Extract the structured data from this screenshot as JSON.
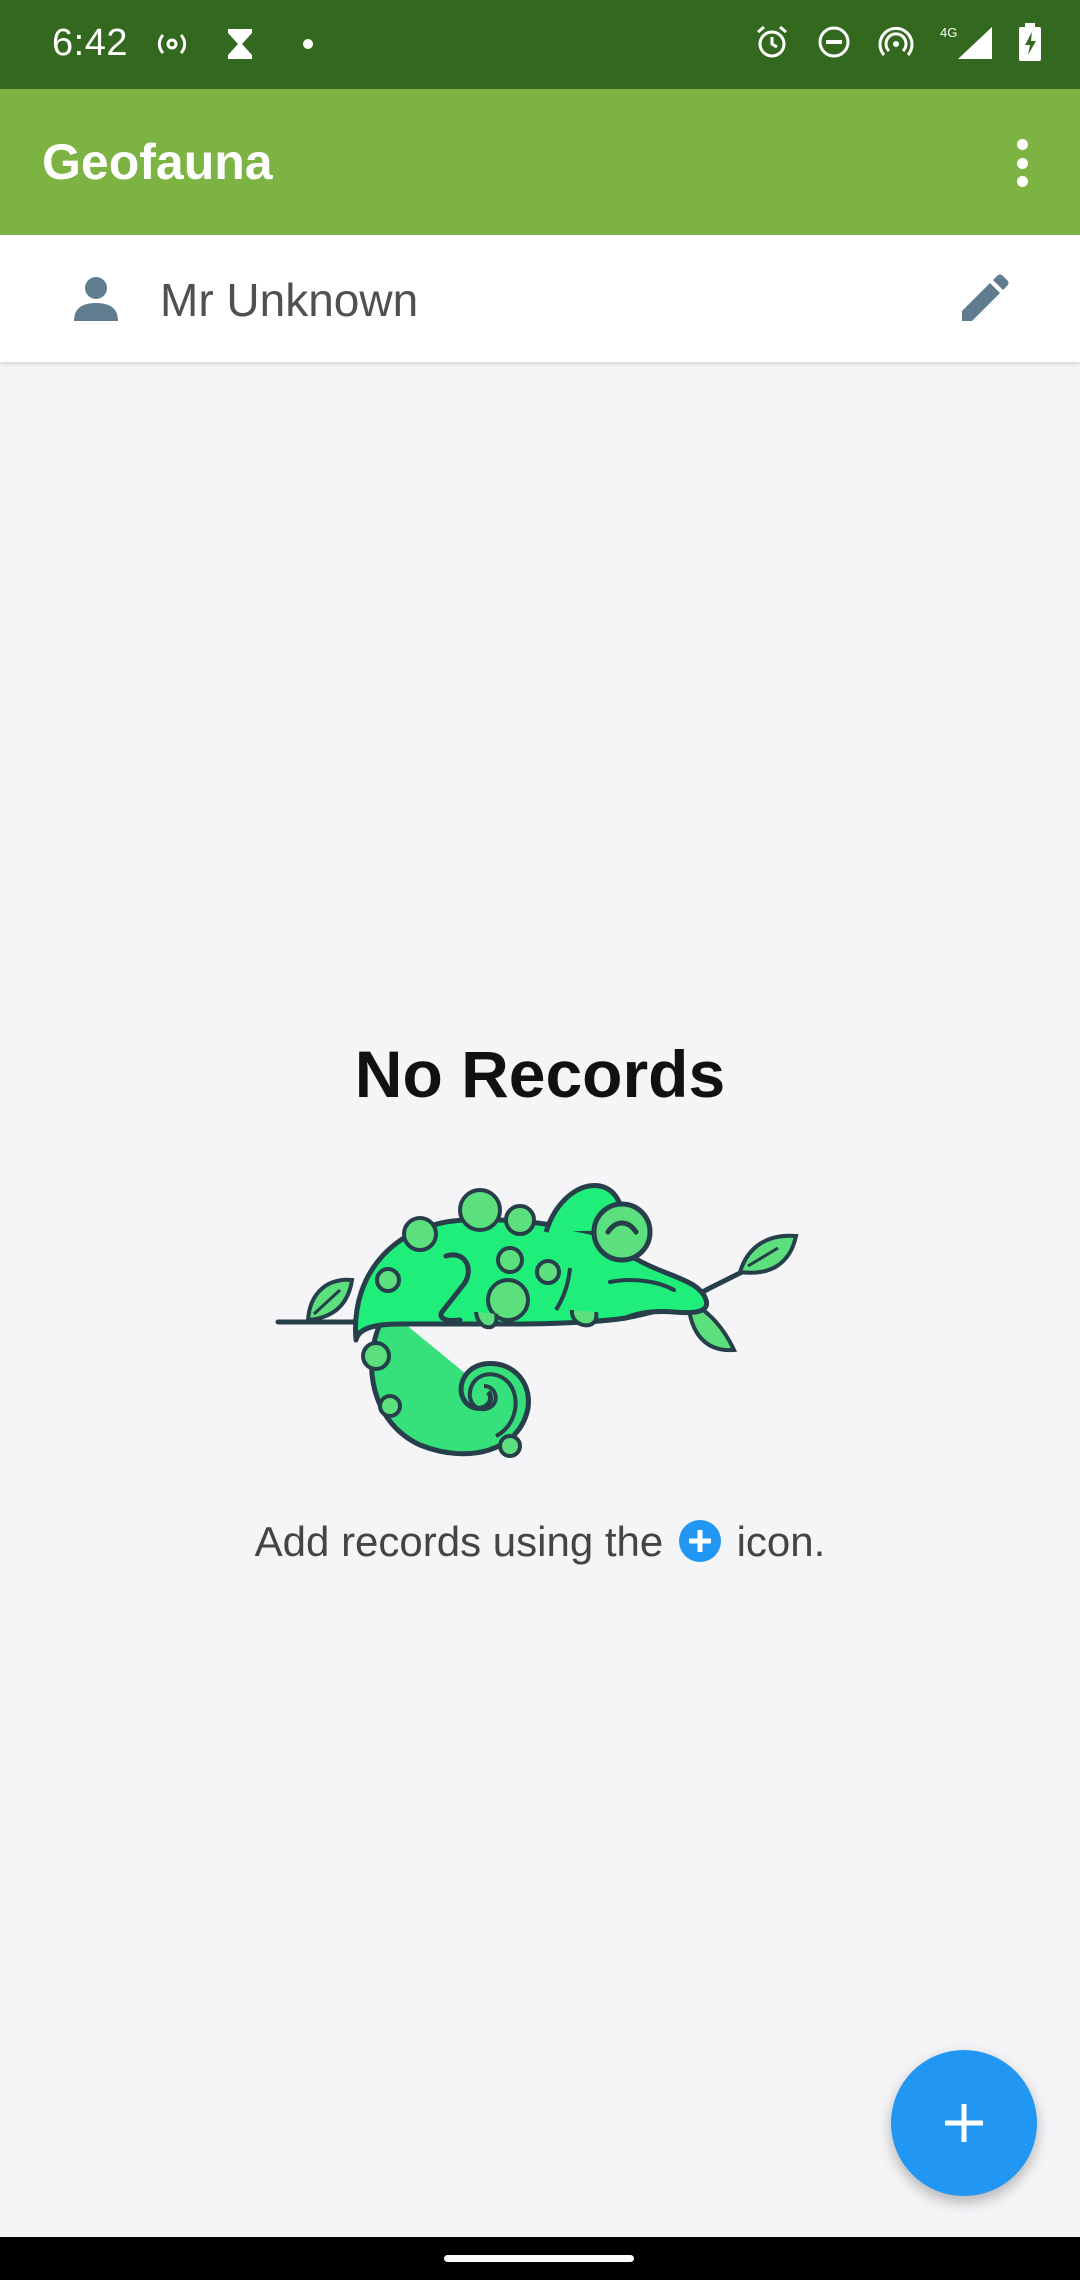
{
  "status_bar": {
    "time": "6:42",
    "left_icons": [
      "hotspot-icon",
      "hourglass-icon",
      "dot-icon"
    ],
    "right_icons": [
      "alarm-icon",
      "dnd-icon",
      "hotspot-icon",
      "signal-4g-icon",
      "battery-charging-icon"
    ],
    "network_label": "4G"
  },
  "app_bar": {
    "title": "Geofauna",
    "menu_icon": "more-vert-icon"
  },
  "user": {
    "name": "Mr Unknown",
    "avatar_icon": "person-icon",
    "edit_icon": "edit-pencil-icon"
  },
  "empty_state": {
    "title": "No Records",
    "hint_before": "Add records using the",
    "hint_after": "icon.",
    "illustration": "chameleon-on-branch"
  },
  "fab": {
    "icon": "add-icon"
  },
  "colors": {
    "status_bar": "#33691e",
    "app_bar": "#7cb342",
    "accent": "#2196f3",
    "background": "#f5f5f8"
  }
}
